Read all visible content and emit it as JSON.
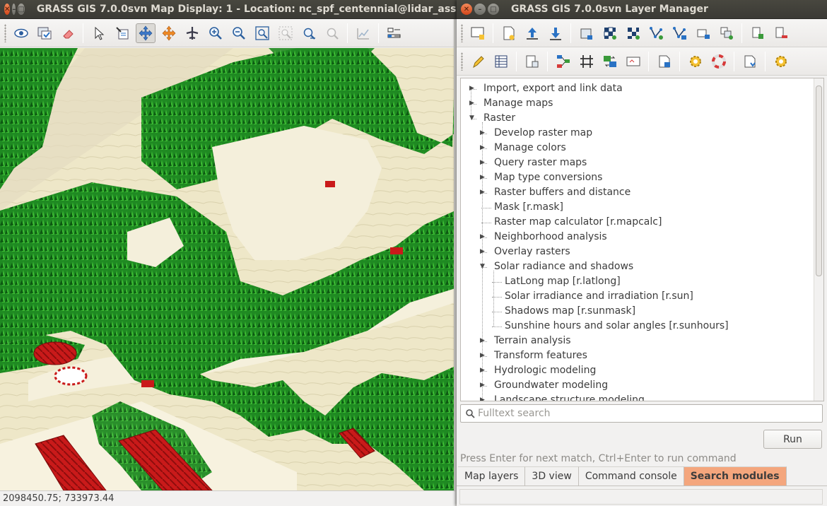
{
  "map_display": {
    "title": "GRASS GIS 7.0.0svn Map Display: 1  - Location: nc_spf_centennial@lidar_assignme",
    "toolbar_icons": [
      "eye-icon",
      "render-map-icon",
      "eraser-icon",
      "pointer-icon",
      "query-icon",
      "pan-icon",
      "zoom-to-extent-orange-icon",
      "airplane-icon",
      "zoom-in-icon",
      "zoom-out-icon",
      "zoom-extent-icon",
      "zoom-back-icon",
      "zoom-options-icon",
      "zoom-region-icon",
      "analyze-icon",
      "decoration-icon"
    ],
    "status_coords": "2098450.75; 733973.44"
  },
  "layer_manager": {
    "title": "GRASS GIS 7.0.0svn Layer Manager",
    "tree": [
      {
        "label": "Import, export and link data"
      },
      {
        "label": "Manage maps"
      },
      {
        "label": "Raster"
      },
      {
        "label": "Develop raster map"
      },
      {
        "label": "Manage colors"
      },
      {
        "label": "Query raster maps"
      },
      {
        "label": "Map type conversions"
      },
      {
        "label": "Raster buffers and distance"
      },
      {
        "label": "Mask   [r.mask]"
      },
      {
        "label": "Raster map calculator   [r.mapcalc]"
      },
      {
        "label": "Neighborhood analysis"
      },
      {
        "label": "Overlay rasters"
      },
      {
        "label": "Solar radiance and shadows"
      },
      {
        "label": "LatLong map   [r.latlong]"
      },
      {
        "label": "Solar irradiance and irradiation   [r.sun]"
      },
      {
        "label": "Shadows map   [r.sunmask]"
      },
      {
        "label": "Sunshine hours and solar angles   [r.sunhours]"
      },
      {
        "label": "Terrain analysis"
      },
      {
        "label": "Transform features"
      },
      {
        "label": "Hydrologic modeling"
      },
      {
        "label": "Groundwater modeling"
      },
      {
        "label": "Landscape structure modeling"
      }
    ],
    "search_placeholder": "Fulltext search",
    "run_label": "Run",
    "hint": "Press Enter for next match, Ctrl+Enter to run command",
    "tabs": [
      {
        "label": "Map layers"
      },
      {
        "label": "3D view"
      },
      {
        "label": "Command console"
      },
      {
        "label": "Search modules"
      }
    ]
  }
}
